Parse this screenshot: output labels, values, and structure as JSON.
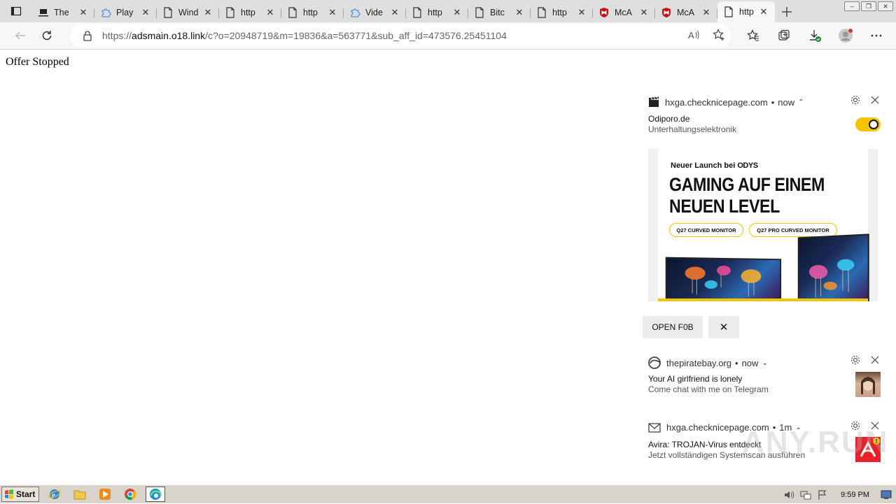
{
  "tabs": [
    {
      "title": "The",
      "icon": "laptop-icon"
    },
    {
      "title": "Play",
      "icon": "puzzle-icon"
    },
    {
      "title": "Wind",
      "icon": "page-icon"
    },
    {
      "title": "http",
      "icon": "page-icon"
    },
    {
      "title": "http",
      "icon": "page-icon"
    },
    {
      "title": "Vide",
      "icon": "puzzle-icon"
    },
    {
      "title": "http",
      "icon": "page-icon"
    },
    {
      "title": "Bitc",
      "icon": "page-icon"
    },
    {
      "title": "http",
      "icon": "page-icon"
    },
    {
      "title": "McA",
      "icon": "mcafee-icon"
    },
    {
      "title": "McA",
      "icon": "mcafee-icon"
    },
    {
      "title": "http",
      "icon": "page-icon",
      "active": true
    }
  ],
  "address": {
    "scheme": "https://",
    "host": "adsmain.o18.link",
    "path": "/c?o=20948719&m=19836&a=563771&sub_aff_id=473576.25451104"
  },
  "page": {
    "text": "Offer Stopped"
  },
  "notifications": [
    {
      "source": "hxga.checknicepage.com",
      "time": "now",
      "title": "Odiporo.de",
      "subtitle": "Unterhaltungselektronik",
      "ad": {
        "small": "Neuer Launch bei",
        "brand": "ODYS",
        "headline1": "GAMING AUF EINEM",
        "headline2": "NEUEN LEVEL",
        "pill1": "Q27 CURVED MONITOR",
        "pill2": "Q27 PRO CURVED MONITOR"
      },
      "button": "OPEN F0B",
      "close_label": "✕"
    },
    {
      "source": "thepiratebay.org",
      "time": "now",
      "title": "Your AI girlfriend is lonely",
      "subtitle": "Come chat with me on Telegram"
    },
    {
      "source": "hxga.checknicepage.com",
      "time": "1m",
      "title": "Avira: TROJAN-Virus entdeckt",
      "subtitle": "Jetzt vollständigen Systemscan ausführen"
    }
  ],
  "taskbar": {
    "start": "Start",
    "clock": "9:59 PM"
  },
  "watermark": "ANY.RUN",
  "colors": {
    "toggle": "#f5c400",
    "avira": "#e8202a",
    "mcafee": "#c01818"
  }
}
